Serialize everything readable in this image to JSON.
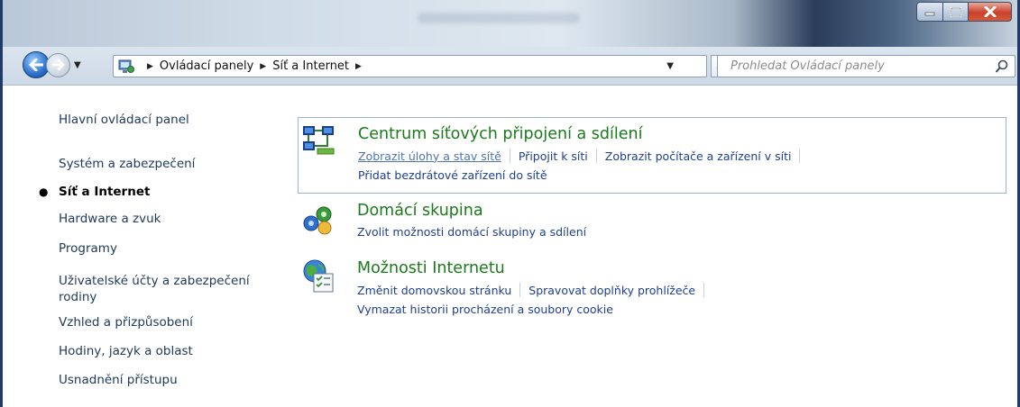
{
  "window": {
    "controls": [
      "minimize",
      "maximize",
      "close"
    ]
  },
  "address": {
    "breadcrumbs": [
      "Ovládací panely",
      "Síť a Internet"
    ],
    "search_placeholder": "Prohledat Ovládací panely"
  },
  "sidebar": {
    "items": [
      {
        "label": "Hlavní ovládací panel",
        "current": false
      },
      {
        "label": "Systém a zabezpečení",
        "current": false
      },
      {
        "label": "Síť a Internet",
        "current": true
      },
      {
        "label": "Hardware a zvuk",
        "current": false
      },
      {
        "label": "Programy",
        "current": false
      },
      {
        "label": "Uživatelské účty a zabezpečení rodiny",
        "current": false
      },
      {
        "label": "Vzhled a přizpůsobení",
        "current": false
      },
      {
        "label": "Hodiny, jazyk a oblast",
        "current": false
      },
      {
        "label": "Usnadnění přístupu",
        "current": false
      }
    ]
  },
  "main": {
    "groups": [
      {
        "title": "Centrum síťových připojení a sdílení",
        "icon": "network-center-icon",
        "links_row1": [
          "Zobrazit úlohy a stav sítě",
          "Připojit k síti",
          "Zobrazit počítače a zařízení v síti"
        ],
        "links_row2": [
          "Přidat bezdrátové zařízení do sítě"
        ]
      },
      {
        "title": "Domácí skupina",
        "icon": "homegroup-icon",
        "links_row1": [
          "Zvolit možnosti domácí skupiny a sdílení"
        ]
      },
      {
        "title": "Možnosti Internetu",
        "icon": "internet-options-icon",
        "links_row1": [
          "Změnit domovskou stránku",
          "Spravovat doplňky prohlížeče"
        ],
        "links_row2": [
          "Vymazat historii procházení a soubory cookie"
        ]
      }
    ]
  },
  "colors": {
    "group_title": "#1b7a1b",
    "link": "#1e3f8f",
    "nav_text": "#1e395b",
    "selection_border": "#9cb3d1"
  }
}
